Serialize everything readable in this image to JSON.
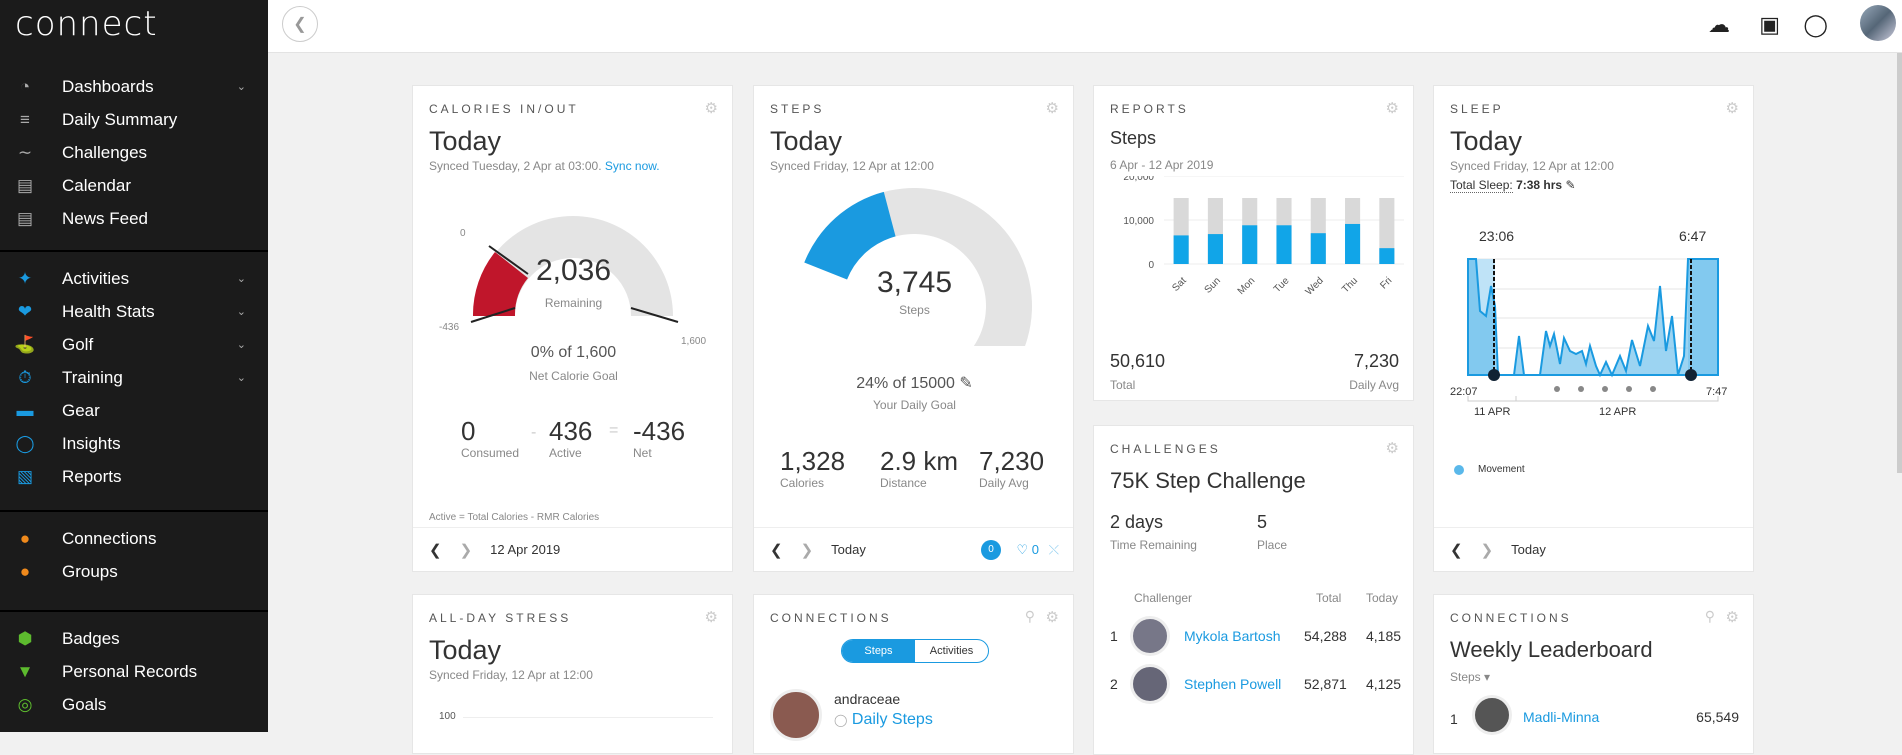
{
  "app": {
    "logo": "connect"
  },
  "sidebar": {
    "groups": [
      [
        {
          "label": "Dashboards",
          "icon": "speedometer-icon",
          "chevron": true
        },
        {
          "label": "Daily Summary",
          "icon": "layers-icon"
        },
        {
          "label": "Challenges",
          "icon": "trend-icon"
        },
        {
          "label": "Calendar",
          "icon": "calendar-icon"
        },
        {
          "label": "News Feed",
          "icon": "newspaper-icon"
        }
      ],
      [
        {
          "label": "Activities",
          "icon": "runner-icon",
          "chevron": true
        },
        {
          "label": "Health Stats",
          "icon": "heart-icon",
          "chevron": true
        },
        {
          "label": "Golf",
          "icon": "golfer-icon",
          "chevron": true
        },
        {
          "label": "Training",
          "icon": "stopwatch-icon",
          "chevron": true
        },
        {
          "label": "Gear",
          "icon": "shoe-icon"
        },
        {
          "label": "Insights",
          "icon": "lightbulb-icon"
        },
        {
          "label": "Reports",
          "icon": "bar-chart-icon"
        }
      ],
      [
        {
          "label": "Connections",
          "icon": "people-icon"
        },
        {
          "label": "Groups",
          "icon": "group-icon"
        }
      ],
      [
        {
          "label": "Badges",
          "icon": "badge-icon"
        },
        {
          "label": "Personal Records",
          "icon": "trophy-icon"
        },
        {
          "label": "Goals",
          "icon": "target-icon"
        }
      ]
    ]
  },
  "calories": {
    "title": "CALORIES IN/OUT",
    "heading": "Today",
    "synced": "Synced Tuesday, 2 Apr at 03:00.",
    "sync_link": "Sync now.",
    "remaining": "2,036",
    "remaining_label": "Remaining",
    "min": "-436",
    "zero": "0",
    "max": "1,600",
    "goal_text": "0% of 1,600",
    "goal_label": "Net Calorie Goal",
    "consumed": "0",
    "consumed_label": "Consumed",
    "minus": "-",
    "active": "436",
    "active_label": "Active",
    "equals": "=",
    "net": "-436",
    "net_label": "Net",
    "note": "Active = Total Calories - RMR Calories",
    "date": "12 Apr 2019"
  },
  "steps": {
    "title": "STEPS",
    "heading": "Today",
    "synced": "Synced Friday, 12 Apr at 12:00",
    "value": "3,745",
    "value_label": "Steps",
    "progress": 0.24,
    "goal_text": "24% of 15000",
    "goal_label": "Your Daily Goal",
    "calories": "1,328",
    "calories_label": "Calories",
    "distance": "2.9 km",
    "distance_label": "Distance",
    "avg": "7,230",
    "avg_label": "Daily Avg",
    "date": "Today",
    "comments": "0",
    "likes": "0"
  },
  "reports": {
    "title": "REPORTS",
    "heading": "Steps",
    "range": "6 Apr - 12 Apr 2019",
    "total": "50,610",
    "total_label": "Total",
    "avg": "7,230",
    "avg_label": "Daily Avg"
  },
  "chart_data": {
    "type": "bar",
    "categories": [
      "Sat",
      "Sun",
      "Mon",
      "Tue",
      "Wed",
      "Thu",
      "Fri"
    ],
    "series": [
      {
        "values": [
          6500,
          6800,
          8800,
          8800,
          7000,
          9100,
          3600
        ]
      }
    ],
    "goal": [
      15000,
      15000,
      15000,
      15000,
      15000,
      15000,
      15000
    ],
    "yticks": [
      "0",
      "10,000",
      "20,000"
    ],
    "ylim": [
      0,
      20000
    ],
    "grid": true
  },
  "sleep": {
    "title": "SLEEP",
    "heading": "Today",
    "synced": "Synced Friday, 12 Apr at 12:00",
    "total_label": "Total Sleep:",
    "total_value": "7:38 hrs",
    "start": "23:06",
    "end": "6:47",
    "axis_start": "22:07",
    "axis_end": "7:47",
    "day1": "11 APR",
    "day2": "12 APR",
    "legend": "Movement",
    "date": "Today",
    "color": "#1a9ae0"
  },
  "stress": {
    "title": "ALL-DAY STRESS",
    "heading": "Today",
    "synced": "Synced Friday, 12 Apr at 12:00",
    "ytick": "100"
  },
  "connections": {
    "title": "CONNECTIONS",
    "tab_steps": "Steps",
    "tab_activities": "Activities",
    "user": "andraceae",
    "activity": "Daily Steps"
  },
  "challenges": {
    "title": "CHALLENGES",
    "heading": "75K Step Challenge",
    "remaining": "2 days",
    "remaining_label": "Time Remaining",
    "place": "5",
    "place_label": "Place",
    "col_challenger": "Challenger",
    "col_total": "Total",
    "col_today": "Today",
    "rows": [
      {
        "rank": "1",
        "name": "Mykola Bartosh",
        "total": "54,288",
        "today": "4,185"
      },
      {
        "rank": "2",
        "name": "Stephen Powell",
        "total": "52,871",
        "today": "4,125"
      }
    ]
  },
  "leaderboard": {
    "title": "CONNECTIONS",
    "heading": "Weekly Leaderboard",
    "metric": "Steps",
    "rows": [
      {
        "rank": "1",
        "name": "Madli-Minna",
        "value": "65,549"
      }
    ]
  }
}
